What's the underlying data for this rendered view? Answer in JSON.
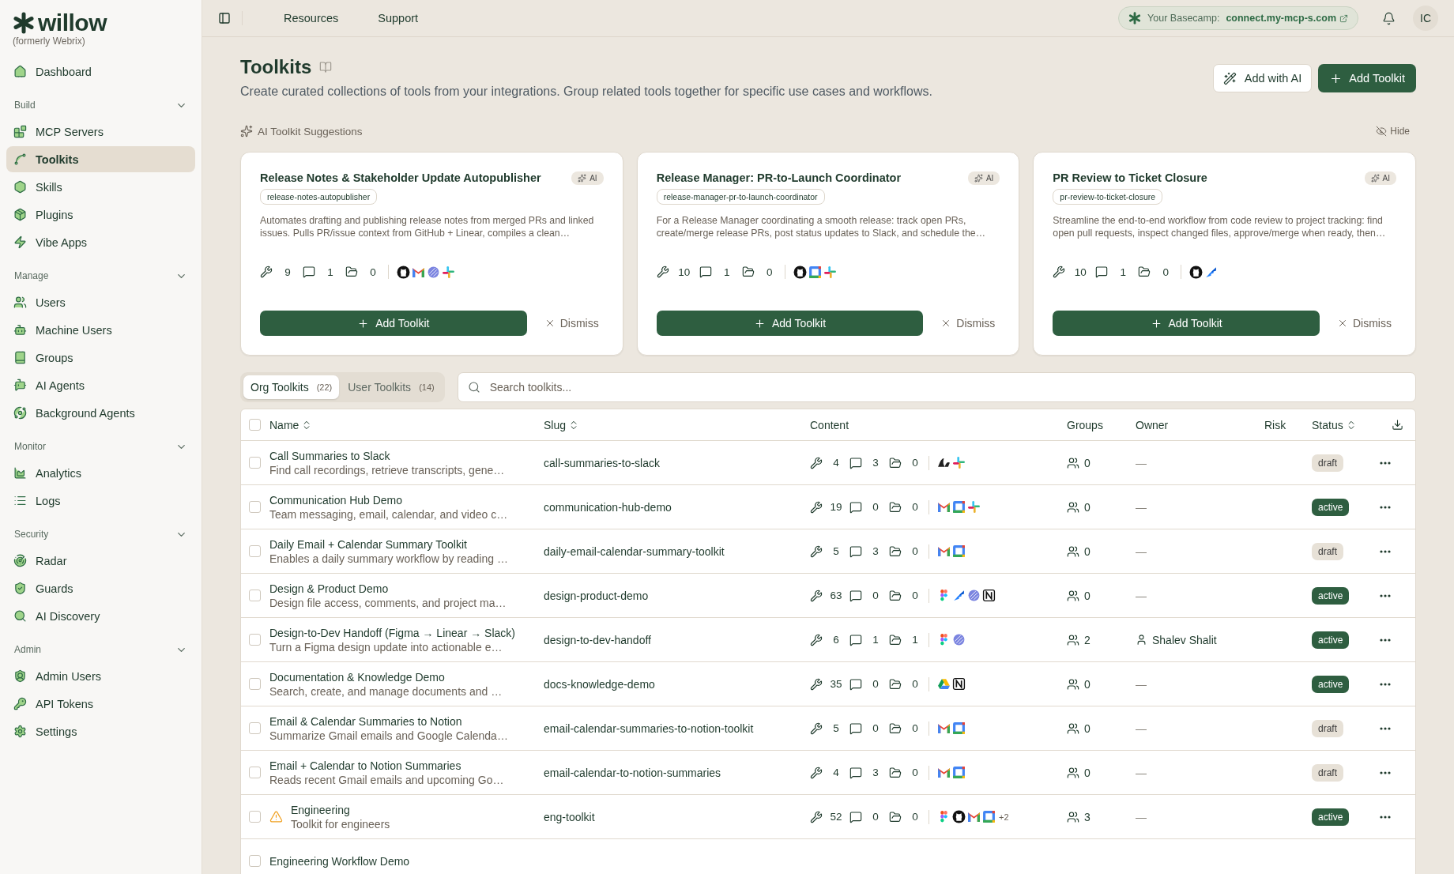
{
  "brand": {
    "name": "willow",
    "subtitle": "(formerly Webrix)"
  },
  "sidebar": {
    "items": [
      {
        "label": "Dashboard",
        "selected": false
      }
    ],
    "sections": [
      {
        "title": "Build",
        "expanded": true,
        "items": [
          {
            "label": "MCP Servers",
            "selected": false
          },
          {
            "label": "Toolkits",
            "selected": true
          },
          {
            "label": "Skills",
            "selected": false
          },
          {
            "label": "Plugins",
            "selected": false
          },
          {
            "label": "Vibe Apps",
            "selected": false
          }
        ]
      },
      {
        "title": "Manage",
        "expanded": true,
        "items": [
          {
            "label": "Users",
            "selected": false
          },
          {
            "label": "Machine Users",
            "selected": false
          },
          {
            "label": "Groups",
            "selected": false
          },
          {
            "label": "AI Agents",
            "selected": false
          },
          {
            "label": "Background Agents",
            "selected": false
          }
        ]
      },
      {
        "title": "Monitor",
        "expanded": true,
        "items": [
          {
            "label": "Analytics",
            "selected": false
          },
          {
            "label": "Logs",
            "selected": false
          }
        ]
      },
      {
        "title": "Security",
        "expanded": true,
        "items": [
          {
            "label": "Radar",
            "selected": false
          },
          {
            "label": "Guards",
            "selected": false
          },
          {
            "label": "AI Discovery",
            "selected": false
          }
        ]
      },
      {
        "title": "Admin",
        "expanded": true,
        "items": [
          {
            "label": "Admin Users",
            "selected": false
          },
          {
            "label": "API Tokens",
            "selected": false
          },
          {
            "label": "Settings",
            "selected": false
          }
        ]
      }
    ]
  },
  "topbar": {
    "links": [
      "Resources",
      "Support"
    ],
    "basecamp_label": "Your Basecamp:",
    "basecamp_url": "connect.my-mcp-s.com",
    "avatar": "IC"
  },
  "page": {
    "title": "Toolkits",
    "description": "Create curated collections of tools from your integrations. Group related tools together for specific use cases and workflows.",
    "add_ai": "Add with AI",
    "add": "Add Toolkit"
  },
  "suggestions": {
    "title": "AI Toolkit Suggestions",
    "hide": "Hide",
    "cards": [
      {
        "title": "Release Notes & Stakeholder Update Autopublisher",
        "badge": "AI",
        "slug": "release-notes-autopublisher",
        "description": "Automates drafting and publishing release notes from merged PRs and linked issues. Pulls PR/issue context from GitHub + Linear, compiles a clean…",
        "tools": "9",
        "prompts": "1",
        "resources": "0",
        "apps": [
          {
            "kind": "github"
          },
          {
            "kind": "gmail"
          },
          {
            "kind": "linear"
          },
          {
            "kind": "slack"
          }
        ],
        "add": "Add Toolkit",
        "dismiss": "Dismiss"
      },
      {
        "title": "Release Manager: PR-to-Launch Coordinator",
        "badge": "AI",
        "slug": "release-manager-pr-to-launch-coordinator",
        "description": "For a Release Manager coordinating a smooth release: track open PRs, create/merge release PRs, post status updates to Slack, and schedule the…",
        "tools": "10",
        "prompts": "1",
        "resources": "0",
        "apps": [
          {
            "kind": "github"
          },
          {
            "kind": "calendar"
          },
          {
            "kind": "slack"
          }
        ],
        "add": "Add Toolkit",
        "dismiss": "Dismiss"
      },
      {
        "title": "PR Review to Ticket Closure",
        "badge": "AI",
        "slug": "pr-review-to-ticket-closure",
        "description": "Streamline the end-to-end workflow from code review to project tracking: find open pull requests, inspect changed files, approve/merge when ready, then…",
        "tools": "10",
        "prompts": "1",
        "resources": "0",
        "apps": [
          {
            "kind": "github"
          },
          {
            "kind": "jira"
          }
        ],
        "add": "Add Toolkit",
        "dismiss": "Dismiss"
      }
    ]
  },
  "tabs": [
    {
      "label": "Org Toolkits",
      "count": "(22)",
      "selected": true
    },
    {
      "label": "User Toolkits",
      "count": "(14)",
      "selected": false
    }
  ],
  "search": {
    "placeholder": "Search toolkits..."
  },
  "table": {
    "all_checked": false,
    "columns": [
      {
        "label": "Name",
        "sortable": true
      },
      {
        "label": "Slug",
        "sortable": true
      },
      {
        "label": "Content",
        "sortable": false
      },
      {
        "label": "Groups",
        "sortable": false
      },
      {
        "label": "Owner",
        "sortable": false
      },
      {
        "label": "Risk",
        "sortable": false
      },
      {
        "label": "Status",
        "sortable": true
      }
    ],
    "rows": [
      {
        "checked": false,
        "warning": false,
        "name": "Call Summaries to Slack",
        "description": "Find call recordings, retrieve transcripts, gene…",
        "slug": "call-summaries-to-slack",
        "tools": "4",
        "prompts": "3",
        "resources": "0",
        "apps": [
          {
            "kind": "gong"
          },
          {
            "kind": "slack"
          }
        ],
        "groups": "0",
        "owner": "—",
        "owner_user": false,
        "status": "draft",
        "active": false
      },
      {
        "checked": false,
        "warning": false,
        "name": "Communication Hub Demo",
        "description": "Team messaging, email, calendar, and video c…",
        "slug": "communication-hub-demo",
        "tools": "19",
        "prompts": "0",
        "resources": "0",
        "apps": [
          {
            "kind": "gmail"
          },
          {
            "kind": "calendar"
          },
          {
            "kind": "slack"
          }
        ],
        "groups": "0",
        "owner": "—",
        "owner_user": false,
        "status": "active",
        "active": true
      },
      {
        "checked": false,
        "warning": false,
        "name": "Daily Email + Calendar Summary Toolkit",
        "description": "Enables a daily summary workflow by reading …",
        "slug": "daily-email-calendar-summary-toolkit",
        "tools": "5",
        "prompts": "3",
        "resources": "0",
        "apps": [
          {
            "kind": "gmail"
          },
          {
            "kind": "calendar"
          }
        ],
        "groups": "0",
        "owner": "—",
        "owner_user": false,
        "status": "draft",
        "active": false
      },
      {
        "checked": false,
        "warning": false,
        "name": "Design & Product Demo",
        "description": "Design file access, comments, and project ma…",
        "slug": "design-product-demo",
        "tools": "63",
        "prompts": "0",
        "resources": "0",
        "apps": [
          {
            "kind": "figma"
          },
          {
            "kind": "jira"
          },
          {
            "kind": "linear"
          },
          {
            "kind": "notion"
          }
        ],
        "groups": "0",
        "owner": "—",
        "owner_user": false,
        "status": "active",
        "active": true
      },
      {
        "checked": false,
        "warning": false,
        "name": "Design-to-Dev Handoff (Figma → Linear → Slack)",
        "description": "Turn a Figma design update into actionable e…",
        "slug": "design-to-dev-handoff",
        "tools": "6",
        "prompts": "1",
        "resources": "1",
        "apps": [
          {
            "kind": "figma"
          },
          {
            "kind": "linear"
          }
        ],
        "groups": "2",
        "owner": "Shalev Shalit",
        "owner_user": true,
        "status": "active",
        "active": true
      },
      {
        "checked": false,
        "warning": false,
        "name": "Documentation & Knowledge Demo",
        "description": "Search, create, and manage documents and …",
        "slug": "docs-knowledge-demo",
        "tools": "35",
        "prompts": "0",
        "resources": "0",
        "apps": [
          {
            "kind": "drive"
          },
          {
            "kind": "notion"
          }
        ],
        "groups": "0",
        "owner": "—",
        "owner_user": false,
        "status": "active",
        "active": true
      },
      {
        "checked": false,
        "warning": false,
        "name": "Email & Calendar Summaries to Notion",
        "description": "Summarize Gmail emails and Google Calenda…",
        "slug": "email-calendar-summaries-to-notion-toolkit",
        "tools": "5",
        "prompts": "0",
        "resources": "0",
        "apps": [
          {
            "kind": "gmail"
          },
          {
            "kind": "calendar"
          }
        ],
        "groups": "0",
        "owner": "—",
        "owner_user": false,
        "status": "draft",
        "active": false
      },
      {
        "checked": false,
        "warning": false,
        "name": "Email + Calendar to Notion Summaries",
        "description": "Reads recent Gmail emails and upcoming Go…",
        "slug": "email-calendar-to-notion-summaries",
        "tools": "4",
        "prompts": "3",
        "resources": "0",
        "apps": [
          {
            "kind": "gmail"
          },
          {
            "kind": "calendar"
          }
        ],
        "groups": "0",
        "owner": "—",
        "owner_user": false,
        "status": "draft",
        "active": false
      },
      {
        "checked": false,
        "warning": true,
        "name": "Engineering",
        "description": "Toolkit for engineers",
        "slug": "eng-toolkit",
        "tools": "52",
        "prompts": "0",
        "resources": "0",
        "apps": [
          {
            "kind": "figma"
          },
          {
            "kind": "github"
          },
          {
            "kind": "gmail"
          },
          {
            "kind": "calendar"
          }
        ],
        "more": "+2",
        "groups": "3",
        "owner": "—",
        "owner_user": false,
        "status": "active",
        "active": true
      },
      {
        "checked": false,
        "warning": false,
        "name": "Engineering Workflow Demo"
      }
    ]
  }
}
